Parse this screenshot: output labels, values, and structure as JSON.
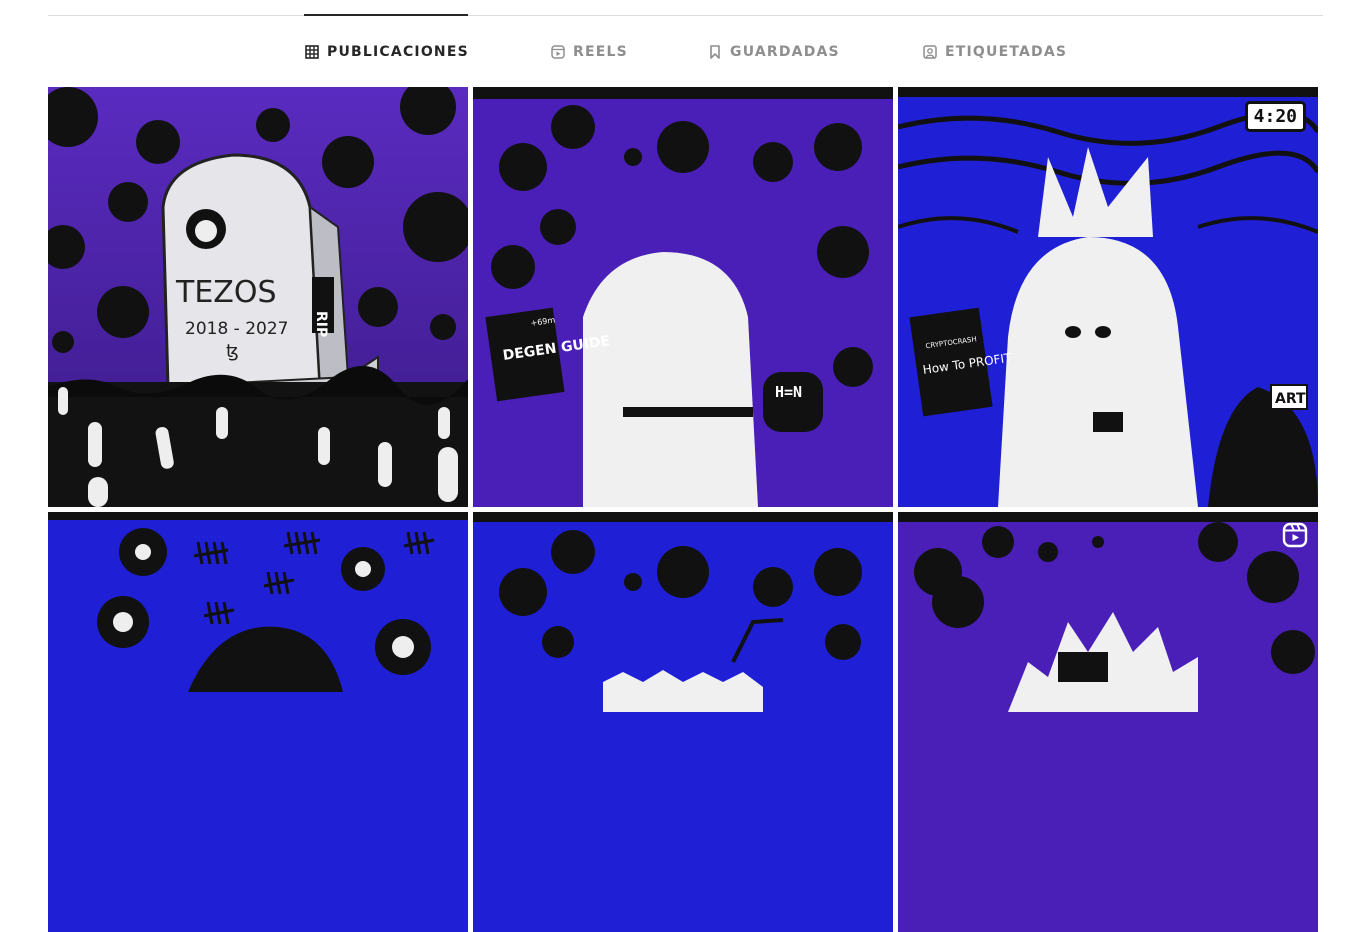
{
  "tabs": [
    {
      "label": "PUBLICACIONES",
      "icon": "grid-icon",
      "active": true
    },
    {
      "label": "REELS",
      "icon": "reels-icon",
      "active": false
    },
    {
      "label": "GUARDADAS",
      "icon": "bookmark-icon",
      "active": false
    },
    {
      "label": "ETIQUETADAS",
      "icon": "tagged-icon",
      "active": false
    }
  ],
  "posts": [
    {
      "title": "TEZOS",
      "dates": "2018 - 2027",
      "tomb_text": "RIP",
      "glyph": "ꜩ"
    },
    {
      "book": "DEGEN GUIDE",
      "book_price": "+69m",
      "sign": "H=N"
    },
    {
      "badge": "4:20",
      "book_top": "CRYPTOCRASH",
      "book": "How To PROFIT",
      "sign": "ART"
    },
    {},
    {},
    {
      "is_reel": true
    }
  ],
  "colors": {
    "purple": "#5a2bc0",
    "blue": "#1f1fd6",
    "black": "#111111",
    "white": "#f2f2f2"
  }
}
